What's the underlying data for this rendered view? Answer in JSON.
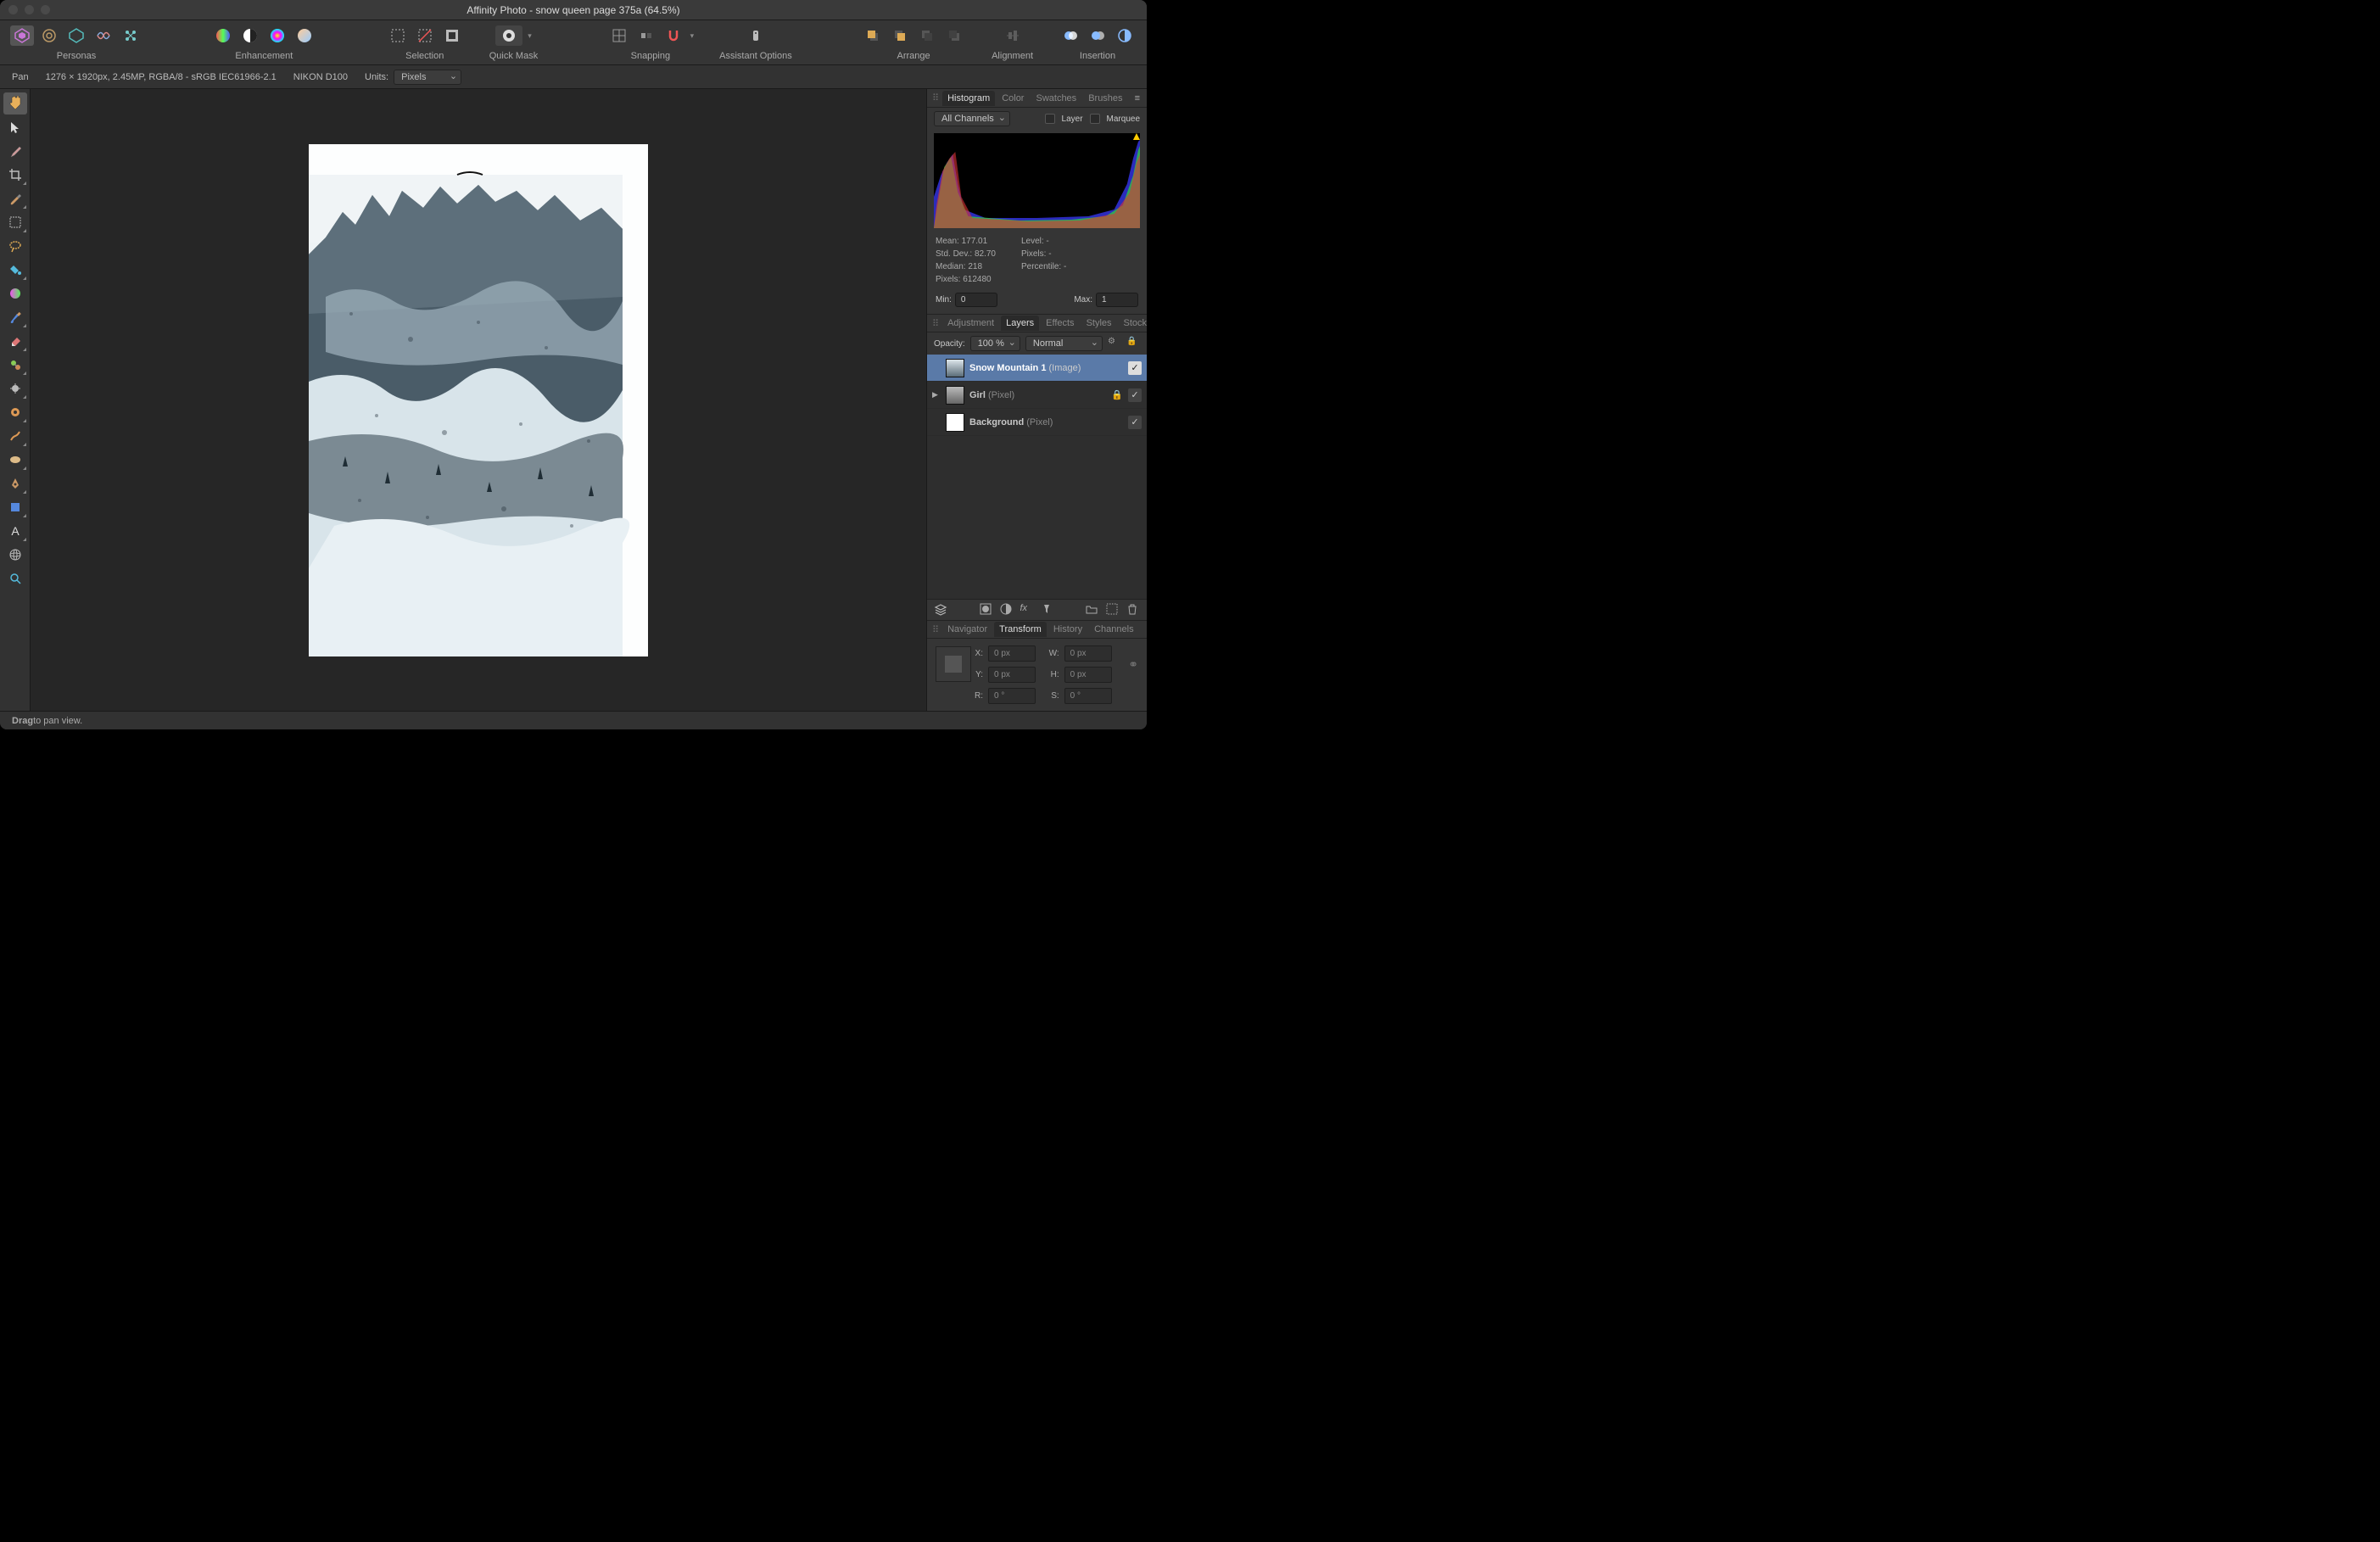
{
  "title": "Affinity Photo - snow queen page 375a (64.5%)",
  "toolbar": {
    "groups": {
      "personas": "Personas",
      "enhancement": "Enhancement",
      "selection": "Selection",
      "quickmask": "Quick Mask",
      "snapping": "Snapping",
      "assistant": "Assistant Options",
      "arrange": "Arrange",
      "alignment": "Alignment",
      "insertion": "Insertion"
    }
  },
  "context": {
    "tool": "Pan",
    "docinfo": "1276 × 1920px, 2.45MP, RGBA/8 - sRGB IEC61966-2.1",
    "camera": "NIKON D100",
    "units_label": "Units:",
    "units_value": "Pixels"
  },
  "histogram": {
    "tabs": {
      "histogram": "Histogram",
      "color": "Color",
      "swatches": "Swatches",
      "brushes": "Brushes"
    },
    "channels_label": "All Channels",
    "layer_label": "Layer",
    "marquee_label": "Marquee",
    "stats": {
      "mean": "Mean: 177.01",
      "stddev": "Std. Dev.: 82.70",
      "median": "Median: 218",
      "pixels": "Pixels: 612480",
      "level": "Level: -",
      "pixels2": "Pixels: -",
      "percentile": "Percentile: -"
    },
    "min_label": "Min:",
    "min_value": "0",
    "max_label": "Max:",
    "max_value": "1"
  },
  "layers": {
    "tabs": {
      "adjustment": "Adjustment",
      "layers": "Layers",
      "effects": "Effects",
      "styles": "Styles",
      "stock": "Stock"
    },
    "opacity_label": "Opacity:",
    "opacity_value": "100 %",
    "blend_value": "Normal",
    "items": [
      {
        "name": "Snow Mountain 1",
        "type": "(Image)",
        "selected": true,
        "expandable": false,
        "locked": false
      },
      {
        "name": "Girl",
        "type": "(Pixel)",
        "selected": false,
        "expandable": true,
        "locked": true
      },
      {
        "name": "Background",
        "type": "(Pixel)",
        "selected": false,
        "expandable": false,
        "locked": false
      }
    ]
  },
  "transform": {
    "tabs": {
      "navigator": "Navigator",
      "transform": "Transform",
      "history": "History",
      "channels": "Channels"
    },
    "x_label": "X:",
    "x_value": "0 px",
    "y_label": "Y:",
    "y_value": "0 px",
    "w_label": "W:",
    "w_value": "0 px",
    "h_label": "H:",
    "h_value": "0 px",
    "r_label": "R:",
    "r_value": "0 °",
    "s_label": "S:",
    "s_value": "0 °"
  },
  "status": {
    "hint_bold": "Drag",
    "hint_rest": " to pan view."
  }
}
